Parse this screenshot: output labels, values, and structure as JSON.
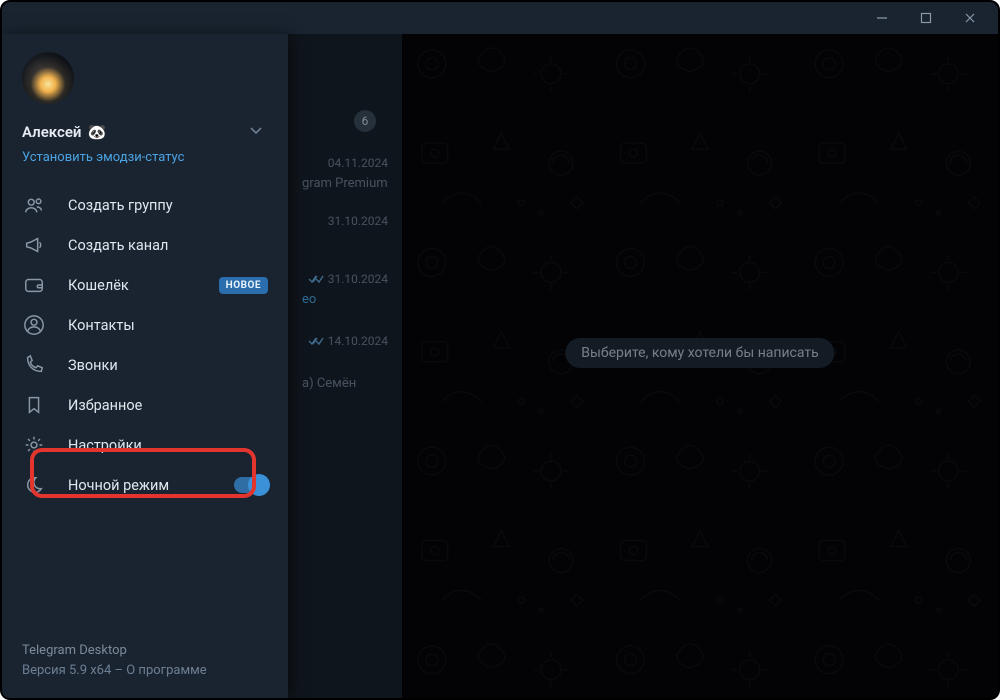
{
  "titlebar": {
    "minimize": "minimize",
    "maximize": "maximize",
    "close": "close"
  },
  "profile": {
    "name": "Алексей",
    "emoji": "🐼",
    "substatus": "Установить эмодзи-статус"
  },
  "menu": {
    "create_group": "Создать группу",
    "create_channel": "Создать канал",
    "wallet": "Кошелёк",
    "wallet_tag": "НОВОЕ",
    "contacts": "Контакты",
    "calls": "Звонки",
    "saved": "Избранное",
    "settings": "Настройки",
    "night_mode": "Ночной режим"
  },
  "footer": {
    "app": "Telegram Desktop",
    "version": "Версия 5.9 x64 – О программе"
  },
  "chatlist": {
    "badge": "6",
    "date1": "04.11.2024",
    "preview1": "gram Premium б...",
    "date2": "31.10.2024",
    "date3": "31.10.2024",
    "preview3": "ео",
    "date4": "14.10.2024",
    "preview4": "а) Семён"
  },
  "placeholder": "Выберите, кому хотели бы написать"
}
